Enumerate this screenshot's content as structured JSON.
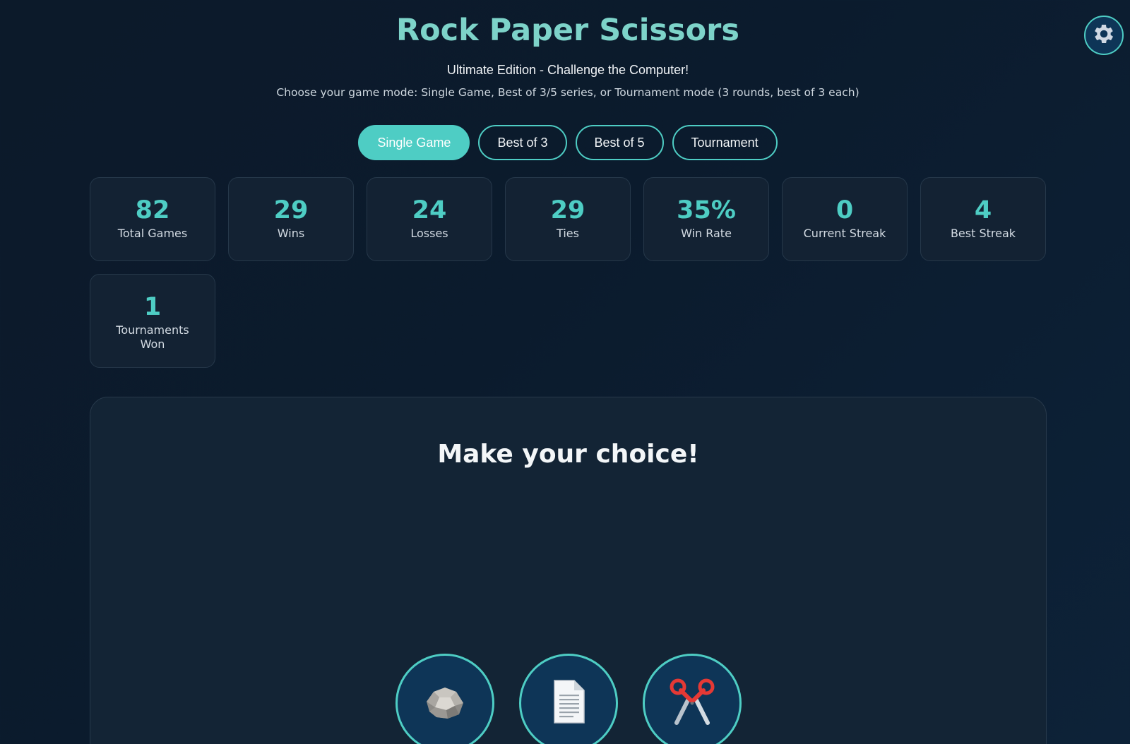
{
  "header": {
    "title": "Rock Paper Scissors",
    "subtitle": "Ultimate Edition - Challenge the Computer!",
    "description": "Choose your game mode: Single Game, Best of 3/5 series, or Tournament mode (3 rounds, best of 3 each)"
  },
  "settings": {
    "icon": "gear-icon"
  },
  "modes": [
    {
      "label": "Single Game",
      "active": true
    },
    {
      "label": "Best of 3",
      "active": false
    },
    {
      "label": "Best of 5",
      "active": false
    },
    {
      "label": "Tournament",
      "active": false
    }
  ],
  "stats": [
    {
      "value": "82",
      "label": "Total Games"
    },
    {
      "value": "29",
      "label": "Wins"
    },
    {
      "value": "24",
      "label": "Losses"
    },
    {
      "value": "29",
      "label": "Ties"
    },
    {
      "value": "35%",
      "label": "Win Rate"
    },
    {
      "value": "0",
      "label": "Current Streak"
    },
    {
      "value": "4",
      "label": "Best Streak"
    },
    {
      "value": "1",
      "label": "Tournaments Won"
    }
  ],
  "game": {
    "prompt": "Make your choice!",
    "choices": [
      {
        "name": "rock",
        "icon": "rock-icon"
      },
      {
        "name": "paper",
        "icon": "paper-icon"
      },
      {
        "name": "scissors",
        "icon": "scissors-icon"
      }
    ]
  },
  "colors": {
    "accent": "#4ecdc4",
    "title": "#7dd3c9",
    "background": "#0c1a2a",
    "card": "#132233",
    "choice_bg": "#0e3557"
  }
}
